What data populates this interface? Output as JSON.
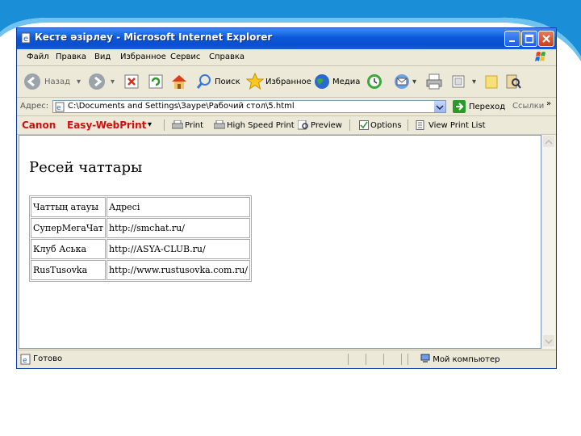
{
  "window": {
    "title": "Кесте әзірлеу - Microsoft Internet Explorer"
  },
  "menu": {
    "items": [
      "Файл",
      "Правка",
      "Вид",
      "Избранное",
      "Сервис",
      "Справка"
    ]
  },
  "toolbar": {
    "back_label": "Назад",
    "search_label": "Поиск",
    "favorites_label": "Избранное",
    "media_label": "Медиа"
  },
  "address": {
    "label": "Адрес:",
    "value": "C:\\Documents and Settings\\Зауре\\Рабочий стол\\5.html",
    "go_label": "Переход",
    "links_label": "Ссылки"
  },
  "canon_bar": {
    "brand": "Canon",
    "product": "Easy-WebPrint",
    "print_label": "Print",
    "hsprint_label": "High Speed Print",
    "preview_label": "Preview",
    "options_label": "Options",
    "viewlist_label": "View Print List"
  },
  "page": {
    "heading": "Ресей чаттары",
    "table": {
      "headers": [
        "Чаттың атауы",
        "Адресі"
      ],
      "rows": [
        [
          "СуперМегаЧат",
          "http://smchat.ru/"
        ],
        [
          "Клуб Аська",
          "http://ASYA-CLUB.ru/"
        ],
        [
          "RusTusovka",
          "http://www.rustusovka.com.ru/"
        ]
      ]
    }
  },
  "status": {
    "text": "Готово",
    "zone": "Мой компьютер"
  },
  "colors": {
    "title_blue": "#0b58d8",
    "slide_accent": "#1a8fd8"
  }
}
